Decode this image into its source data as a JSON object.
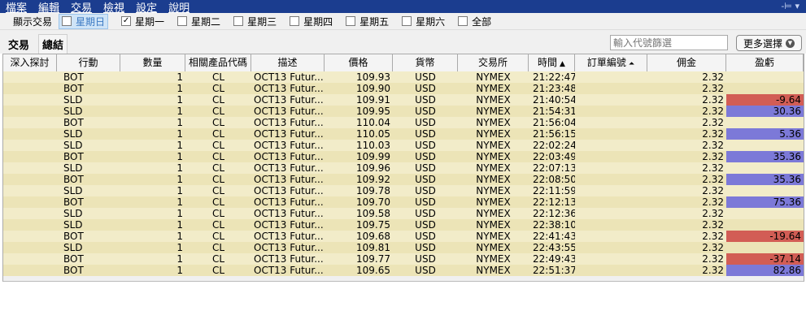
{
  "menu": [
    "檔案",
    "編輯",
    "交易",
    "檢視",
    "設定",
    "說明"
  ],
  "pin_icon": "pin-icon",
  "days_bar": {
    "label": "顯示交易",
    "days": [
      {
        "label": "星期日",
        "checked": false,
        "highlighted": true
      },
      {
        "label": "星期一",
        "checked": true,
        "highlighted": false
      },
      {
        "label": "星期二",
        "checked": false,
        "highlighted": false
      },
      {
        "label": "星期三",
        "checked": false,
        "highlighted": false
      },
      {
        "label": "星期四",
        "checked": false,
        "highlighted": false
      },
      {
        "label": "星期五",
        "checked": false,
        "highlighted": false
      },
      {
        "label": "星期六",
        "checked": false,
        "highlighted": false
      },
      {
        "label": "全部",
        "checked": false,
        "highlighted": false
      }
    ]
  },
  "tabs": [
    "交易",
    "總結"
  ],
  "filter": {
    "placeholder": "輸入代號篩選"
  },
  "more_button": {
    "label": "更多選擇"
  },
  "columns": [
    {
      "key": "explore",
      "label": "深入探討"
    },
    {
      "key": "action",
      "label": "行動"
    },
    {
      "key": "qty",
      "label": "數量"
    },
    {
      "key": "symbol",
      "label": "相關產品代碼"
    },
    {
      "key": "desc",
      "label": "描述"
    },
    {
      "key": "price",
      "label": "價格"
    },
    {
      "key": "currency",
      "label": "貨幣"
    },
    {
      "key": "exchange",
      "label": "交易所"
    },
    {
      "key": "time",
      "label": "時間",
      "sort": "asc"
    },
    {
      "key": "order_ref",
      "label": "訂單編號",
      "sort": "icon"
    },
    {
      "key": "commission",
      "label": "佣金"
    },
    {
      "key": "pnl",
      "label": "盈虧"
    }
  ],
  "rows": [
    {
      "action": "BOT",
      "qty": "1",
      "symbol": "CL",
      "desc": "OCT13 Futur...",
      "price": "109.93",
      "currency": "USD",
      "exchange": "NYMEX",
      "time": "21:22:47",
      "commission": "2.32",
      "pnl": ""
    },
    {
      "action": "BOT",
      "qty": "1",
      "symbol": "CL",
      "desc": "OCT13 Futur...",
      "price": "109.90",
      "currency": "USD",
      "exchange": "NYMEX",
      "time": "21:23:48",
      "commission": "2.32",
      "pnl": ""
    },
    {
      "action": "SLD",
      "qty": "1",
      "symbol": "CL",
      "desc": "OCT13 Futur...",
      "price": "109.91",
      "currency": "USD",
      "exchange": "NYMEX",
      "time": "21:40:54",
      "commission": "2.32",
      "pnl": "-9.64"
    },
    {
      "action": "SLD",
      "qty": "1",
      "symbol": "CL",
      "desc": "OCT13 Futur...",
      "price": "109.95",
      "currency": "USD",
      "exchange": "NYMEX",
      "time": "21:54:31",
      "commission": "2.32",
      "pnl": "30.36"
    },
    {
      "action": "BOT",
      "qty": "1",
      "symbol": "CL",
      "desc": "OCT13 Futur...",
      "price": "110.04",
      "currency": "USD",
      "exchange": "NYMEX",
      "time": "21:56:04",
      "commission": "2.32",
      "pnl": ""
    },
    {
      "action": "SLD",
      "qty": "1",
      "symbol": "CL",
      "desc": "OCT13 Futur...",
      "price": "110.05",
      "currency": "USD",
      "exchange": "NYMEX",
      "time": "21:56:15",
      "commission": "2.32",
      "pnl": "5.36"
    },
    {
      "action": "SLD",
      "qty": "1",
      "symbol": "CL",
      "desc": "OCT13 Futur...",
      "price": "110.03",
      "currency": "USD",
      "exchange": "NYMEX",
      "time": "22:02:24",
      "commission": "2.32",
      "pnl": ""
    },
    {
      "action": "BOT",
      "qty": "1",
      "symbol": "CL",
      "desc": "OCT13 Futur...",
      "price": "109.99",
      "currency": "USD",
      "exchange": "NYMEX",
      "time": "22:03:49",
      "commission": "2.32",
      "pnl": "35.36"
    },
    {
      "action": "SLD",
      "qty": "1",
      "symbol": "CL",
      "desc": "OCT13 Futur...",
      "price": "109.96",
      "currency": "USD",
      "exchange": "NYMEX",
      "time": "22:07:13",
      "commission": "2.32",
      "pnl": ""
    },
    {
      "action": "BOT",
      "qty": "1",
      "symbol": "CL",
      "desc": "OCT13 Futur...",
      "price": "109.92",
      "currency": "USD",
      "exchange": "NYMEX",
      "time": "22:08:50",
      "commission": "2.32",
      "pnl": "35.36"
    },
    {
      "action": "SLD",
      "qty": "1",
      "symbol": "CL",
      "desc": "OCT13 Futur...",
      "price": "109.78",
      "currency": "USD",
      "exchange": "NYMEX",
      "time": "22:11:59",
      "commission": "2.32",
      "pnl": ""
    },
    {
      "action": "BOT",
      "qty": "1",
      "symbol": "CL",
      "desc": "OCT13 Futur...",
      "price": "109.70",
      "currency": "USD",
      "exchange": "NYMEX",
      "time": "22:12:13",
      "commission": "2.32",
      "pnl": "75.36"
    },
    {
      "action": "SLD",
      "qty": "1",
      "symbol": "CL",
      "desc": "OCT13 Futur...",
      "price": "109.58",
      "currency": "USD",
      "exchange": "NYMEX",
      "time": "22:12:36",
      "commission": "2.32",
      "pnl": ""
    },
    {
      "action": "SLD",
      "qty": "1",
      "symbol": "CL",
      "desc": "OCT13 Futur...",
      "price": "109.75",
      "currency": "USD",
      "exchange": "NYMEX",
      "time": "22:38:10",
      "commission": "2.32",
      "pnl": ""
    },
    {
      "action": "BOT",
      "qty": "1",
      "symbol": "CL",
      "desc": "OCT13 Futur...",
      "price": "109.68",
      "currency": "USD",
      "exchange": "NYMEX",
      "time": "22:41:43",
      "commission": "2.32",
      "pnl": "-19.64"
    },
    {
      "action": "SLD",
      "qty": "1",
      "symbol": "CL",
      "desc": "OCT13 Futur...",
      "price": "109.81",
      "currency": "USD",
      "exchange": "NYMEX",
      "time": "22:43:55",
      "commission": "2.32",
      "pnl": ""
    },
    {
      "action": "BOT",
      "qty": "1",
      "symbol": "CL",
      "desc": "OCT13 Futur...",
      "price": "109.77",
      "currency": "USD",
      "exchange": "NYMEX",
      "time": "22:49:43",
      "commission": "2.32",
      "pnl": "-37.14"
    },
    {
      "action": "BOT",
      "qty": "1",
      "symbol": "CL",
      "desc": "OCT13 Futur...",
      "price": "109.65",
      "currency": "USD",
      "exchange": "NYMEX",
      "time": "22:51:37",
      "commission": "2.32",
      "pnl": "82.86"
    }
  ],
  "colors": {
    "menu_bg": "#1b3d8f",
    "row_light": "#f2ecc9",
    "row_dark": "#ece4b7",
    "pnl_negative": "#d25d55",
    "pnl_positive": "#7c79d8"
  }
}
